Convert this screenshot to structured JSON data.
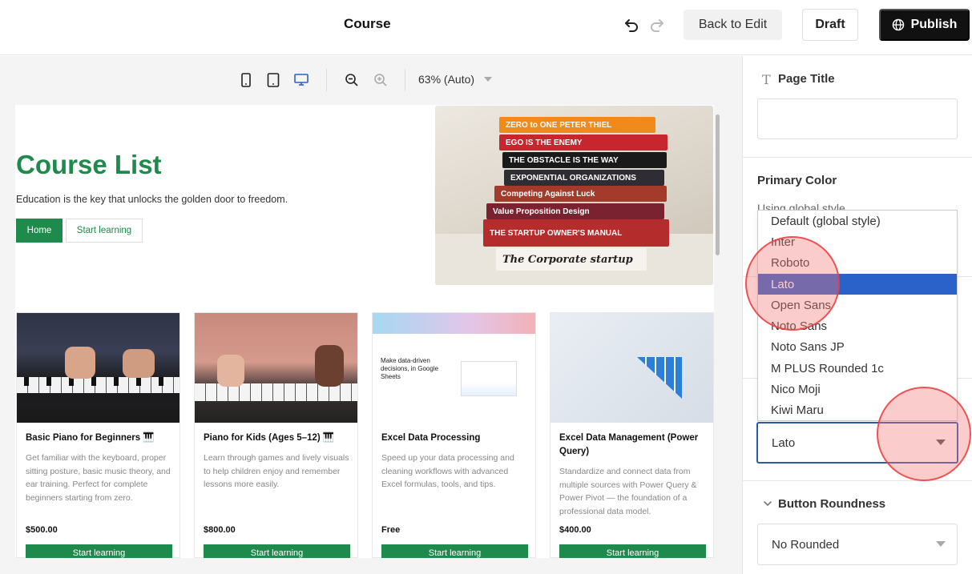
{
  "header": {
    "title": "Course",
    "back_label": "Back to Edit",
    "draft_label": "Draft",
    "publish_label": "Publish"
  },
  "toolbar": {
    "zoom": "63% (Auto)"
  },
  "preview": {
    "hero_title": "Course List",
    "hero_subtitle": "Education is the key that unlocks the golden door to freedom.",
    "home_label": "Home",
    "start_label": "Start learning",
    "books": [
      "ZERO to ONE   PETER THIEL",
      "EGO IS THE ENEMY",
      "THE OBSTACLE IS THE WAY",
      "EXPONENTIAL ORGANIZATIONS",
      "Competing Against Luck",
      "Value Proposition Design",
      "THE STARTUP OWNER'S MANUAL",
      "The Corporate startup"
    ],
    "cards": [
      {
        "title": "Basic Piano for Beginners 🎹",
        "desc": "Get familiar with the keyboard, proper sitting posture, basic music theory, and ear training. Perfect for complete beginners starting from zero.",
        "price": "$500.00",
        "button": "Start learning"
      },
      {
        "title": "Piano for Kids (Ages 5–12) 🎹",
        "desc": "Learn through games and lively visuals to help children enjoy and remember lessons more easily.",
        "price": "$800.00",
        "button": "Start learning"
      },
      {
        "title": "Excel Data Processing",
        "desc": "Speed up your data processing and cleaning workflows with advanced Excel formulas, tools, and tips.",
        "price": "Free",
        "button": "Start learning"
      },
      {
        "title": "Excel Data Management (Power Query)",
        "desc": "Standardize and connect data from multiple sources with Power Query & Power Pivot — the foundation of a professional data model.",
        "price": "$400.00",
        "button": "Start learning"
      }
    ],
    "sheets_text": "Make data-driven decisions, in Google Sheets"
  },
  "sidebar": {
    "page_title_label": "Page Title",
    "page_title_value": "",
    "primary_color_label": "Primary Color",
    "primary_color_hint": "Using global style",
    "font_options": [
      "Default (global style)",
      "Inter",
      "Roboto",
      "Lato",
      "Open Sans",
      "Noto Sans",
      "Noto Sans JP",
      "M PLUS Rounded 1c",
      "Nico Moji",
      "Kiwi Maru"
    ],
    "font_selected": "Lato",
    "button_roundness_label": "Button Roundness",
    "button_roundness_value": "No Rounded"
  },
  "colors": {
    "brand_green": "#1e8a4c",
    "selection_blue": "#2a62c9",
    "publish_bg": "#111111"
  }
}
